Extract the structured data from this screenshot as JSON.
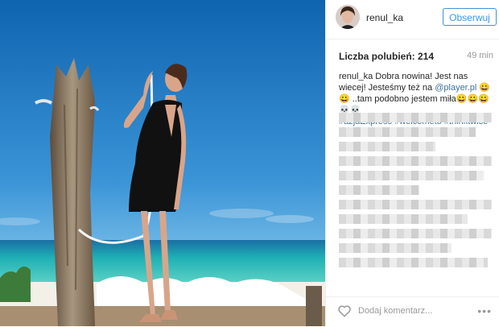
{
  "header": {
    "username": "renul_ka",
    "follow_label": "Obserwuj"
  },
  "stats": {
    "likes_label": "Liczba polubień: 214",
    "time_ago": "49 min"
  },
  "caption": {
    "username": "renul_ka",
    "text_parts": [
      "Dobra nowina! Jest nas wiecej! Jesteśmy też na ",
      "@player.pl",
      " 😀😀 ..tam podobno jestem miła😀😀😀💀💀"
    ],
    "hashtags": [
      "#azjaExpress",
      "#welcometo",
      "#thinktwice"
    ]
  },
  "footer": {
    "add_comment_placeholder": "Dodaj komentarz...",
    "more_label": "•••"
  },
  "colors": {
    "accent": "#3897f0",
    "hashtag": "#3f729b",
    "sky": "#1b73b8",
    "sea": "#1fb0b5"
  },
  "icons": {
    "like": "heart-outline-icon",
    "more": "more-dots-icon"
  }
}
